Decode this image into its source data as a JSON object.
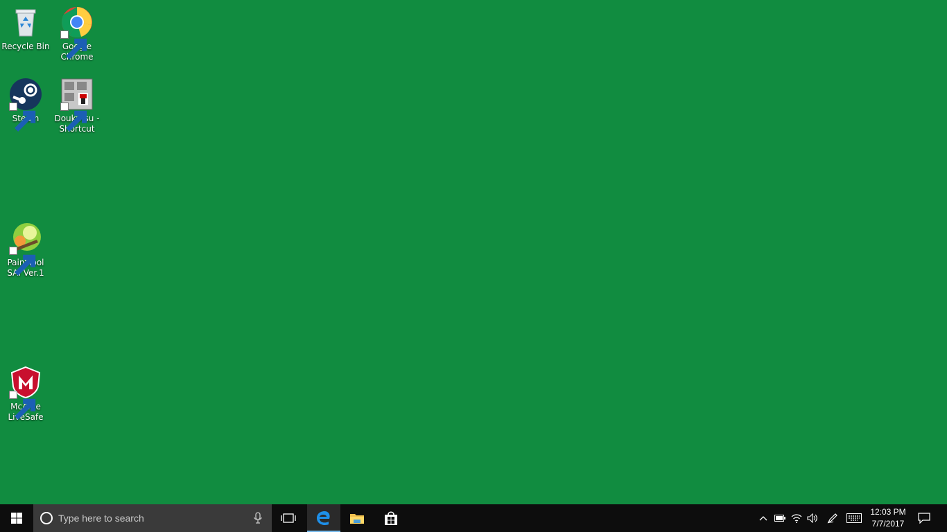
{
  "desktop": {
    "icons": [
      {
        "label": "Recycle Bin",
        "icon": "recycle-bin-icon"
      },
      {
        "label": "Google Chrome",
        "icon": "chrome-icon"
      },
      {
        "label": "Steam",
        "icon": "steam-icon"
      },
      {
        "label": "Doukutsu - Shortcut",
        "icon": "doukutsu-icon"
      },
      {
        "label": "PaintTool SAI Ver.1",
        "icon": "painttool-sai-icon"
      },
      {
        "label": "McAfee LiveSafe",
        "icon": "mcafee-icon"
      }
    ],
    "background_color": "#118c40"
  },
  "taskbar": {
    "search_placeholder": "Type here to search",
    "pinned": [
      "start-icon",
      "task-view-icon",
      "edge-icon",
      "file-explorer-icon",
      "store-icon"
    ],
    "clock": {
      "time": "12:03 PM",
      "date": "7/7/2017"
    },
    "tray": [
      "chevron-up-icon",
      "battery-icon",
      "wifi-icon",
      "volume-icon",
      "pen-icon",
      "keyboard-icon",
      "action-center-icon"
    ],
    "accent_color": "#76b9ed"
  }
}
